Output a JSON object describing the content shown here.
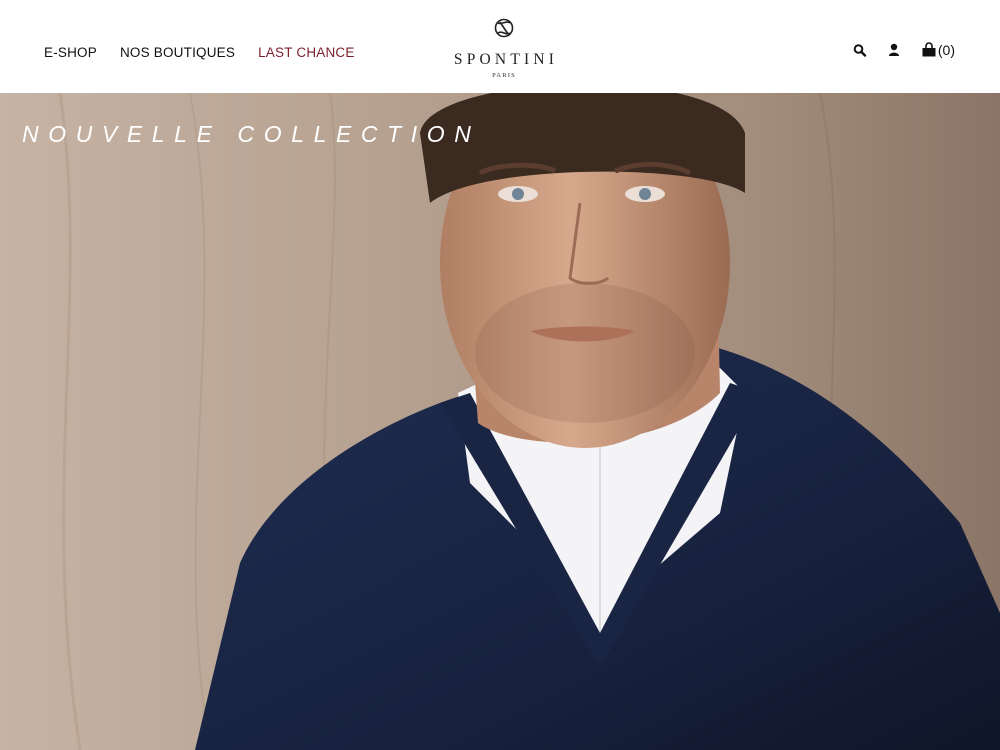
{
  "nav": {
    "items": [
      {
        "label": "E-SHOP"
      },
      {
        "label": "NOS BOUTIQUES"
      },
      {
        "label": "LAST CHANCE"
      }
    ]
  },
  "logo": {
    "name": "SPONTINI",
    "subtitle": "PARIS"
  },
  "utilities": {
    "search_icon": "search-icon",
    "account_icon": "user-icon",
    "cart_icon": "shopping-bag-icon",
    "cart_count": "(0)"
  },
  "hero": {
    "title": "NOUVELLE COLLECTION"
  },
  "colors": {
    "accent": "#7a1f2b",
    "text": "#111111"
  }
}
